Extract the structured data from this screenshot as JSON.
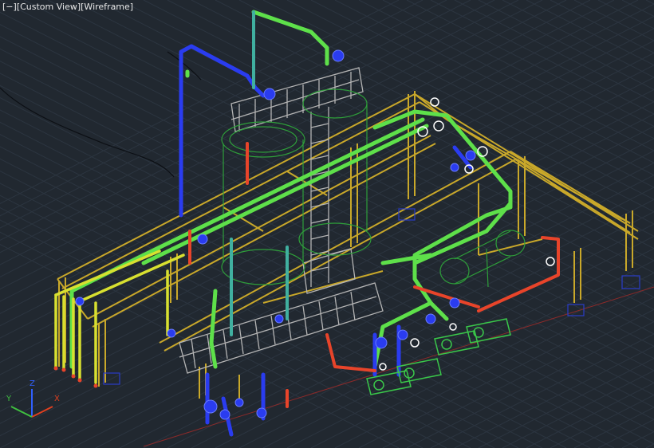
{
  "viewport": {
    "controls": {
      "viewport_menu": "[−]",
      "view_name": "[Custom View]",
      "visual_style": "[Wireframe]"
    },
    "colors": {
      "background": "#212830",
      "grid": "#2c3540",
      "steel_structure": "#c9a82a",
      "pipe_green": "#5ee04a",
      "pipe_blue": "#2a3cf0",
      "pipe_red": "#e8442a",
      "pipe_yellow": "#d8e030",
      "platform_railing": "#b4b4b4",
      "equipment_outline": "#2e9e3a"
    }
  },
  "ucs_icon": {
    "x_label": "X",
    "y_label": "Y",
    "z_label": "Z",
    "x_color": "#e04020",
    "y_color": "#40c040",
    "z_color": "#3060ff"
  }
}
